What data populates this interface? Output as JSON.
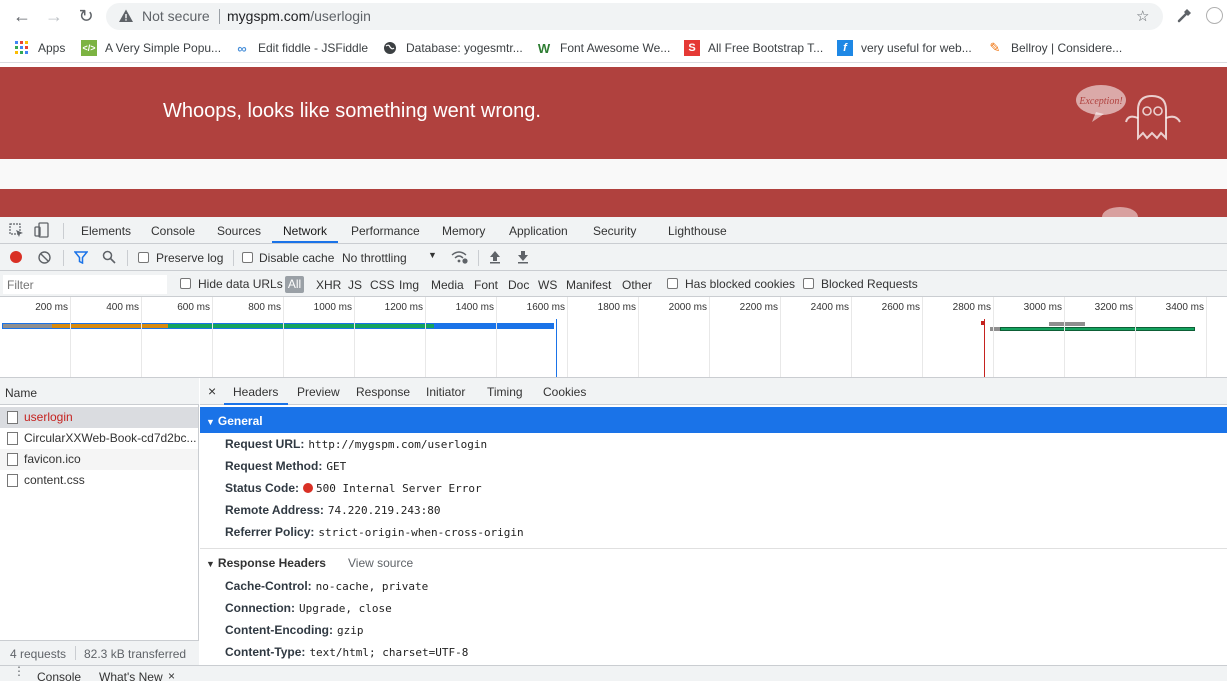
{
  "browser": {
    "security_label": "Not secure",
    "url_host": "mygspm.com",
    "url_path": "/userlogin",
    "bookmarks": [
      {
        "label": "Apps",
        "icon": "apps-grid-icon",
        "color": "#4285f4"
      },
      {
        "label": "A Very Simple Popu...",
        "icon": "code-icon",
        "color": "#7cb342"
      },
      {
        "label": "Edit fiddle - JSFiddle",
        "icon": "jsfiddle-icon",
        "color": "#4a90d9"
      },
      {
        "label": "Database: yogesmtr...",
        "icon": "globe-icon",
        "color": "#3c4043"
      },
      {
        "label": "Font Awesome We...",
        "icon": "w-logo-icon",
        "color": "#2e7d32"
      },
      {
        "label": "All Free Bootstrap T...",
        "icon": "s-logo-icon",
        "color": "#e53935"
      },
      {
        "label": "very useful for web...",
        "icon": "f-logo-icon",
        "color": "#1e88e5"
      },
      {
        "label": "Bellroy | Considere...",
        "icon": "bellroy-icon",
        "color": "#ef6c00"
      }
    ]
  },
  "page": {
    "error_message": "Whoops, looks like something went wrong.",
    "exception_badge": "Exception!",
    "hero_color": "#b0413e"
  },
  "devtools": {
    "tabs": [
      "Elements",
      "Console",
      "Sources",
      "Network",
      "Performance",
      "Memory",
      "Application",
      "Security",
      "Lighthouse"
    ],
    "active_tab": "Network",
    "toolbar": {
      "preserve_log": "Preserve log",
      "disable_cache": "Disable cache",
      "throttling": "No throttling"
    },
    "filterbar": {
      "filter_placeholder": "Filter",
      "hide_data_urls": "Hide data URLs",
      "all": "All",
      "types": [
        "XHR",
        "JS",
        "CSS",
        "Img",
        "Media",
        "Font",
        "Doc",
        "WS",
        "Manifest",
        "Other"
      ],
      "has_blocked_cookies": "Has blocked cookies",
      "blocked_requests": "Blocked Requests"
    },
    "timeline_ticks": [
      "200 ms",
      "400 ms",
      "600 ms",
      "800 ms",
      "1000 ms",
      "1200 ms",
      "1400 ms",
      "1600 ms",
      "1800 ms",
      "2000 ms",
      "2200 ms",
      "2400 ms",
      "2600 ms",
      "2800 ms",
      "3000 ms",
      "3200 ms",
      "3400 ms"
    ],
    "requests": {
      "column_name": "Name",
      "items": [
        {
          "name": "userlogin",
          "error": true
        },
        {
          "name": "CircularXXWeb-Book-cd7d2bc...",
          "error": false
        },
        {
          "name": "favicon.ico",
          "error": false
        },
        {
          "name": "content.css",
          "error": false
        }
      ],
      "count": "4 requests",
      "transferred": "82.3 kB transferred"
    },
    "details": {
      "close": "×",
      "tabs": [
        "Headers",
        "Preview",
        "Response",
        "Initiator",
        "Timing",
        "Cookies"
      ],
      "active_tab": "Headers",
      "general_title": "General",
      "general": [
        {
          "key": "Request URL:",
          "value": "http://mygspm.com/userlogin"
        },
        {
          "key": "Request Method:",
          "value": "GET"
        },
        {
          "key": "Status Code:",
          "value": "500 Internal Server Error",
          "status_dot": true
        },
        {
          "key": "Remote Address:",
          "value": "74.220.219.243:80"
        },
        {
          "key": "Referrer Policy:",
          "value": "strict-origin-when-cross-origin"
        }
      ],
      "response_title": "Response Headers",
      "view_source": "View source",
      "response": [
        {
          "key": "Cache-Control:",
          "value": "no-cache, private"
        },
        {
          "key": "Connection:",
          "value": "Upgrade, close"
        },
        {
          "key": "Content-Encoding:",
          "value": "gzip"
        },
        {
          "key": "Content-Type:",
          "value": "text/html; charset=UTF-8"
        }
      ]
    },
    "drawer_tabs": [
      "Console",
      "What's New"
    ]
  }
}
